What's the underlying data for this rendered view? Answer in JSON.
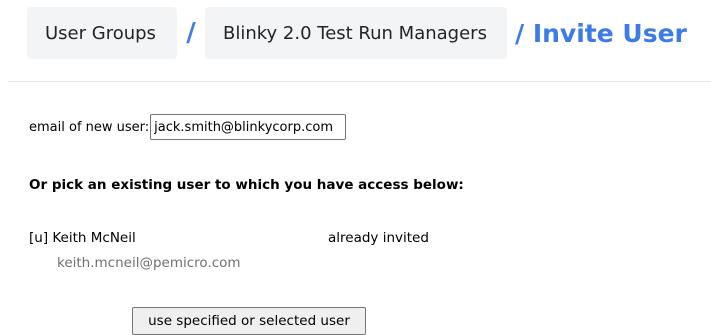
{
  "breadcrumb": {
    "items": [
      {
        "label": "User Groups"
      },
      {
        "label": "Blinky 2.0 Test Run Managers"
      }
    ],
    "separator": "/",
    "current": "/ Invite User"
  },
  "email_form": {
    "label": "email of new user:",
    "value": "jack.smith@blinkycorp.com"
  },
  "existing_users": {
    "heading": "Or pick an existing user to which you have access below:",
    "users": [
      {
        "name": "[u] Keith McNeil",
        "status": "already invited",
        "email": "keith.mcneil@pemicro.com"
      }
    ]
  },
  "submit_button": {
    "label": "use specified or selected user"
  },
  "colors": {
    "accent": "#3c7be8",
    "crumb_background": "#f3f4f6",
    "secondary_text": "#707070"
  }
}
